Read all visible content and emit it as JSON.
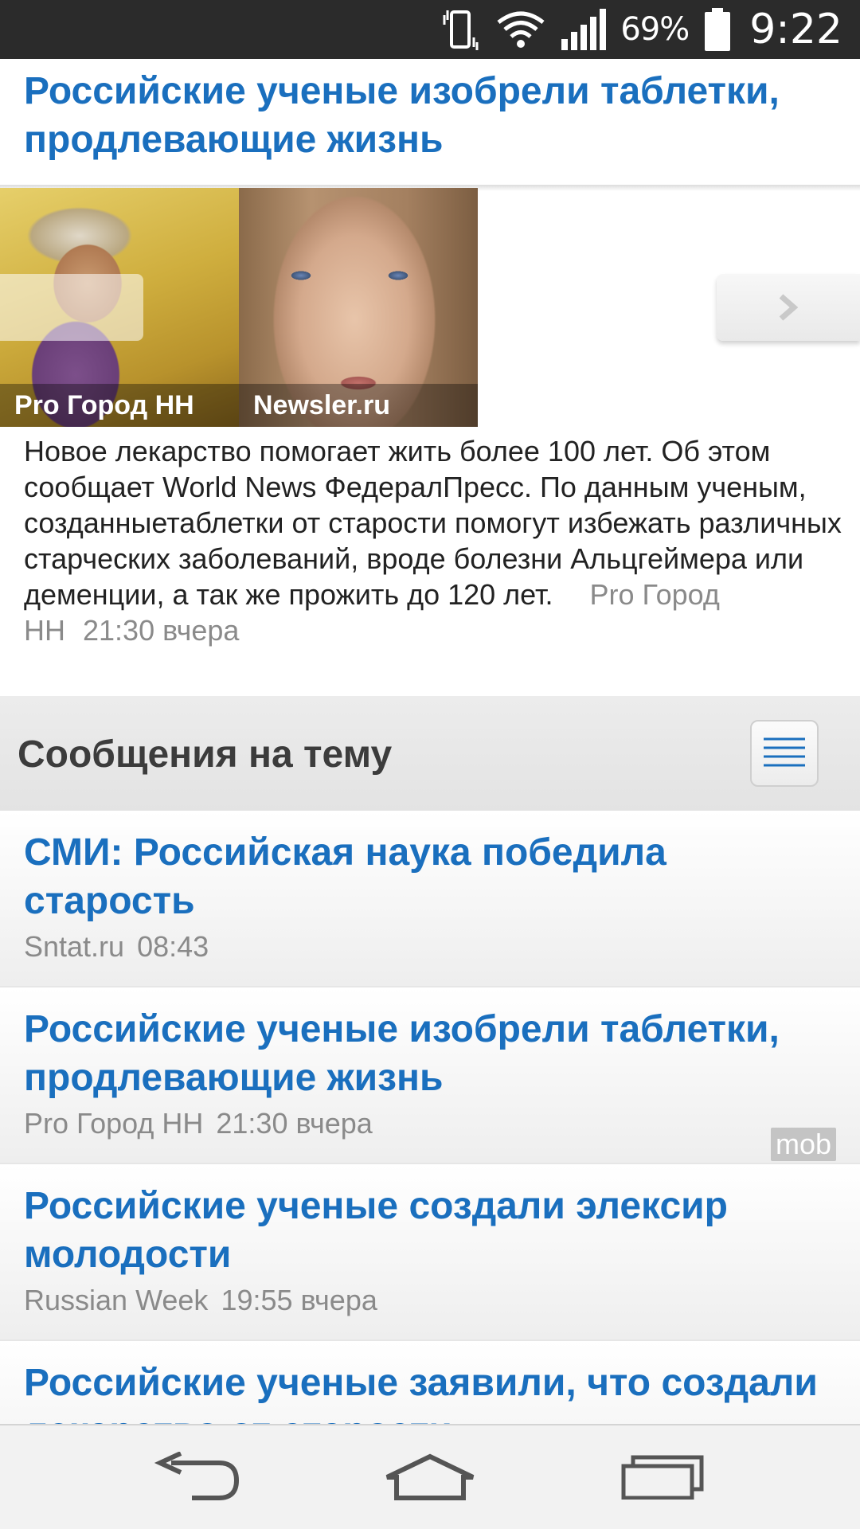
{
  "status_bar": {
    "battery_percent": "69%",
    "time": "9:22",
    "icons": [
      "vibrate-icon",
      "wifi-icon",
      "signal-icon",
      "battery-icon"
    ]
  },
  "article": {
    "title": "Российские ученые изобрели таблетки, продлевающие жизнь",
    "gallery": [
      {
        "caption": "Pro Город НН"
      },
      {
        "caption": "Newsler.ru"
      }
    ],
    "body": "Новое лекарство помогает жить более 100 лет. Об этом сообщает World News ФедералПресс. По данным ученым, созданныетаблетки от старости помогут избежать различных старческих заболеваний, вроде болезни Альцгеймера или деменции, а так же прожить до 120 лет.",
    "source": "Pro Город НН",
    "time": "21:30 вчера"
  },
  "related": {
    "title": "Сообщения на тему",
    "items": [
      {
        "title": "СМИ: Российская наука победила старость",
        "source": "Sntat.ru",
        "time": "08:43",
        "badge": ""
      },
      {
        "title": "Российские ученые изобрели таблетки, продлевающие жизнь",
        "source": "Pro Город НН",
        "time": "21:30 вчера",
        "badge": "mob"
      },
      {
        "title": "Российские ученые создали элексир молодости",
        "source": "Russian Week",
        "time": "19:55 вчера",
        "badge": ""
      },
      {
        "title": "Российские ученые заявили, что создали лекарство от старости",
        "source": "",
        "time": "",
        "badge": ""
      }
    ]
  },
  "colors": {
    "link_blue": "#1a6fbe",
    "meta_gray": "#8a8a8a",
    "status_bar": "#2b2b2b",
    "section_bg": "#e8e8e8"
  }
}
